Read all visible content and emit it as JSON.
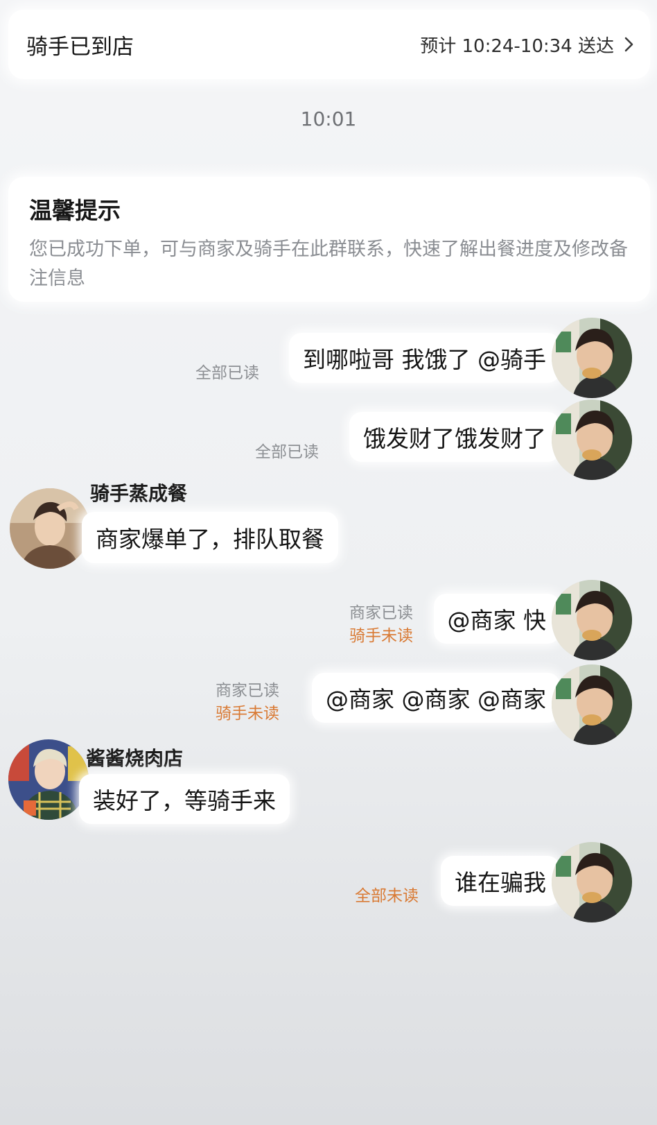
{
  "header": {
    "status_title": "骑手已到店",
    "eta_text": "预计 10:24-10:34 送达"
  },
  "timestamp": "10:01",
  "tip": {
    "title": "温馨提示",
    "body": "您已成功下单，可与商家及骑手在此群联系，快速了解出餐进度及修改备注信息"
  },
  "messages": [
    {
      "side": "right",
      "text": "到哪啦哥 我饿了 @骑手",
      "receipt": [
        "全部已读"
      ]
    },
    {
      "side": "right",
      "text": "饿发财了饿发财了",
      "receipt": [
        "全部已读"
      ]
    },
    {
      "side": "left",
      "sender": "骑手蒸成餐",
      "text": "商家爆单了，排队取餐"
    },
    {
      "side": "right",
      "text": "@商家 快",
      "receipt": [
        "商家已读",
        "骑手未读"
      ]
    },
    {
      "side": "right",
      "text": "@商家 @商家 @商家",
      "receipt": [
        "商家已读",
        "骑手未读"
      ]
    },
    {
      "side": "left",
      "sender": "酱酱烧肉店",
      "text": "装好了，等骑手来"
    },
    {
      "side": "right",
      "text": "谁在骗我",
      "receipt": [
        "全部未读"
      ]
    }
  ],
  "colors": {
    "unread_accent": "#d97a34",
    "read_gray": "#8c8f93"
  }
}
